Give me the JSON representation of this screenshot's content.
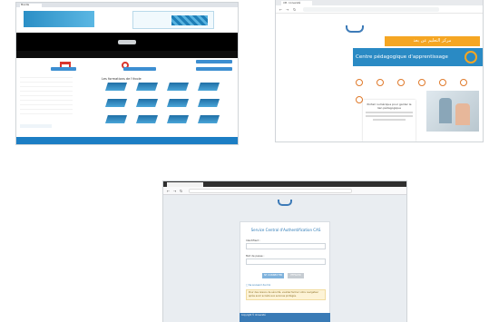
{
  "shot1": {
    "tab_title": "Moodle",
    "banner_text": "",
    "strip_label": "",
    "grid_title": "Les formations de l'école",
    "sidebar_items": [
      "",
      "",
      "",
      "",
      "",
      "",
      "",
      "",
      ""
    ],
    "courses": [
      "",
      "",
      "",
      "",
      "",
      "",
      "",
      "",
      "",
      "",
      "",
      ""
    ]
  },
  "shot2": {
    "tab_title": "UM - Université",
    "url": "",
    "nav": [
      "",
      "",
      "",
      ""
    ],
    "logo_text": "",
    "arabic_top": "مركز التعليم عن بعد",
    "hero_text": "Centre pédagogique d'apprentissage",
    "card_title": "Portail numérique pour garder le lien pédagogique",
    "accent_color": "#2a8ac4",
    "orange_color": "#f5a623"
  },
  "shot3": {
    "tab_title": "",
    "url": "",
    "logo_text": "",
    "panel_title": "Service Central d'Authentification CAS",
    "username_label": "Identifiant :",
    "password_label": "Mot de passe :",
    "login_button": "SE CONNECTER",
    "clear_button": "EFFACER",
    "remember": "Se souvenir de moi",
    "note": "Pour des raisons de sécurité, veuillez fermer votre navigateur après avoir accédé aux services protégés.",
    "footer": "Copyright © Université"
  }
}
